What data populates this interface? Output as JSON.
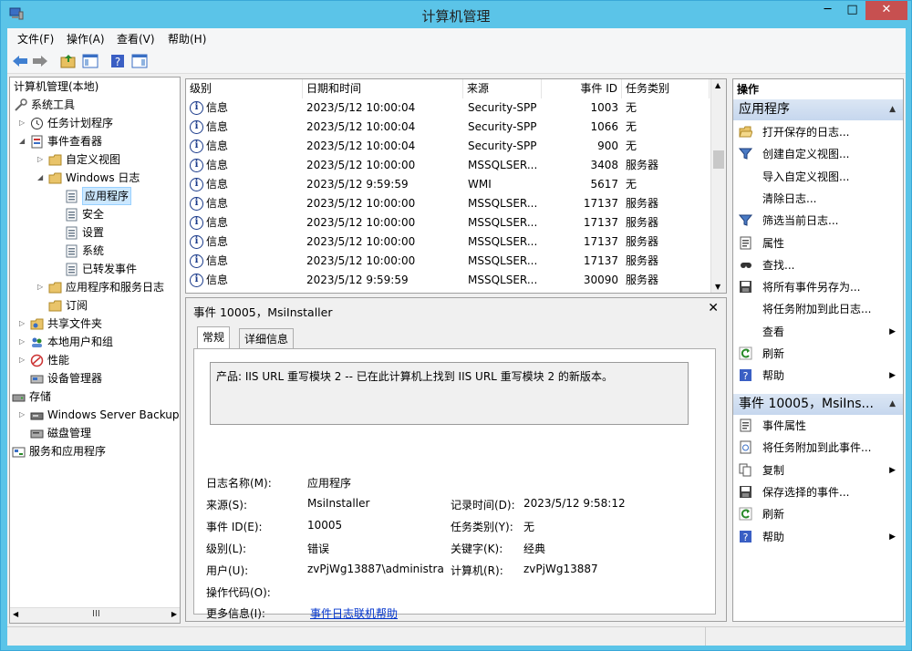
{
  "window": {
    "title": "计算机管理"
  },
  "menus": [
    "文件(F)",
    "操作(A)",
    "查看(V)",
    "帮助(H)"
  ],
  "tree": [
    {
      "label": "计算机管理(本地)",
      "icon": "computer-icon"
    },
    {
      "label": "系统工具",
      "icon": "tools-icon"
    },
    {
      "label": "任务计划程序",
      "icon": "clock-icon"
    },
    {
      "label": "事件查看器",
      "icon": "event-viewer-icon"
    },
    {
      "label": "自定义视图",
      "icon": "folder-icon"
    },
    {
      "label": "Windows 日志",
      "icon": "folder-icon"
    },
    {
      "label": "应用程序",
      "icon": "log-icon"
    },
    {
      "label": "安全",
      "icon": "log-icon"
    },
    {
      "label": "设置",
      "icon": "log-icon"
    },
    {
      "label": "系统",
      "icon": "log-icon"
    },
    {
      "label": "已转发事件",
      "icon": "log-icon"
    },
    {
      "label": "应用程序和服务日志",
      "icon": "folder-icon"
    },
    {
      "label": "订阅",
      "icon": "folder-icon"
    },
    {
      "label": "共享文件夹",
      "icon": "shared-folder-icon"
    },
    {
      "label": "本地用户和组",
      "icon": "users-icon"
    },
    {
      "label": "性能",
      "icon": "performance-icon"
    },
    {
      "label": "设备管理器",
      "icon": "device-manager-icon"
    },
    {
      "label": "存储",
      "icon": "storage-icon"
    },
    {
      "label": "Windows Server Backup",
      "icon": "backup-icon"
    },
    {
      "label": "磁盘管理",
      "icon": "disk-icon"
    },
    {
      "label": "服务和应用程序",
      "icon": "services-icon"
    }
  ],
  "list": {
    "columns": [
      "级别",
      "日期和时间",
      "来源",
      "事件 ID",
      "任务类别"
    ],
    "rows": [
      [
        "信息",
        "2023/5/12 10:00:04",
        "Security-SPP",
        "1003",
        "无"
      ],
      [
        "信息",
        "2023/5/12 10:00:04",
        "Security-SPP",
        "1066",
        "无"
      ],
      [
        "信息",
        "2023/5/12 10:00:04",
        "Security-SPP",
        "900",
        "无"
      ],
      [
        "信息",
        "2023/5/12 10:00:00",
        "MSSQLSER...",
        "3408",
        "服务器"
      ],
      [
        "信息",
        "2023/5/12 9:59:59",
        "WMI",
        "5617",
        "无"
      ],
      [
        "信息",
        "2023/5/12 10:00:00",
        "MSSQLSER...",
        "17137",
        "服务器"
      ],
      [
        "信息",
        "2023/5/12 10:00:00",
        "MSSQLSER...",
        "17137",
        "服务器"
      ],
      [
        "信息",
        "2023/5/12 10:00:00",
        "MSSQLSER...",
        "17137",
        "服务器"
      ],
      [
        "信息",
        "2023/5/12 10:00:00",
        "MSSQLSER...",
        "17137",
        "服务器"
      ],
      [
        "信息",
        "2023/5/12 9:59:59",
        "MSSQLSER...",
        "30090",
        "服务器"
      ]
    ]
  },
  "detail": {
    "title": "事件 10005，MsiInstaller",
    "tabs": [
      "常规",
      "详细信息"
    ],
    "description": "产品: IIS URL 重写模块 2 -- 已在此计算机上找到 IIS URL 重写模块 2 的新版本。",
    "fields": {
      "log_name_label": "日志名称(M):",
      "log_name": "应用程序",
      "source_label": "来源(S):",
      "source": "MsiInstaller",
      "logged_label": "记录时间(D):",
      "logged": "2023/5/12 9:58:12",
      "event_id_label": "事件 ID(E):",
      "event_id": "10005",
      "task_label": "任务类别(Y):",
      "task": "无",
      "level_label": "级别(L):",
      "level": "错误",
      "keywords_label": "关键字(K):",
      "keywords": "经典",
      "user_label": "用户(U):",
      "user": "zvPjWg13887\\administrato",
      "computer_label": "计算机(R):",
      "computer": "zvPjWg13887",
      "opcode_label": "操作代码(O):",
      "more_info_label": "更多信息(I):",
      "more_info_link": "事件日志联机帮助"
    }
  },
  "actions": {
    "header": "操作",
    "section1": {
      "title": "应用程序",
      "items": [
        {
          "label": "打开保存的日志...",
          "icon": "open-folder-icon"
        },
        {
          "label": "创建自定义视图...",
          "icon": "filter-icon"
        },
        {
          "label": "导入自定义视图...",
          "icon": ""
        },
        {
          "label": "清除日志...",
          "icon": ""
        },
        {
          "label": "筛选当前日志...",
          "icon": "filter-icon"
        },
        {
          "label": "属性",
          "icon": "properties-icon"
        },
        {
          "label": "查找...",
          "icon": "find-icon"
        },
        {
          "label": "将所有事件另存为...",
          "icon": "save-icon"
        },
        {
          "label": "将任务附加到此日志...",
          "icon": ""
        },
        {
          "label": "查看",
          "icon": "",
          "submenu": true
        },
        {
          "label": "刷新",
          "icon": "refresh-icon"
        },
        {
          "label": "帮助",
          "icon": "help-icon",
          "submenu": true
        }
      ]
    },
    "section2": {
      "title": "事件 10005，MsiIns...",
      "items": [
        {
          "label": "事件属性",
          "icon": "properties-icon"
        },
        {
          "label": "将任务附加到此事件...",
          "icon": "task-icon"
        },
        {
          "label": "复制",
          "icon": "copy-icon",
          "submenu": true
        },
        {
          "label": "保存选择的事件...",
          "icon": "save-icon"
        },
        {
          "label": "刷新",
          "icon": "refresh-icon"
        },
        {
          "label": "帮助",
          "icon": "help-icon",
          "submenu": true
        }
      ]
    }
  },
  "tree_scroll_glyph": "III"
}
